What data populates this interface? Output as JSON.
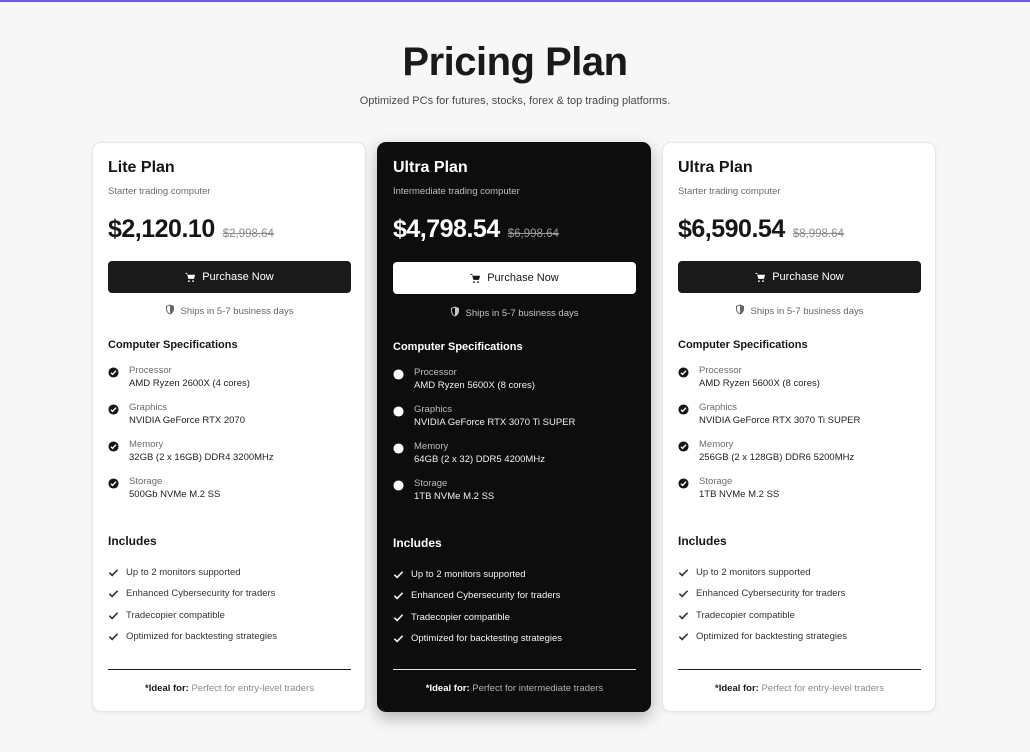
{
  "header": {
    "title": "Pricing Plan",
    "subtitle": "Optimized PCs for futures, stocks, forex & top trading platforms."
  },
  "plans": [
    {
      "name": "Lite Plan",
      "tagline": "Starter trading computer",
      "price": "$2,120.10",
      "old_price": "$2,998.64",
      "button_label": "Purchase Now",
      "ships": "Ships in 5-7 business days",
      "specs_heading": "Computer Specifications",
      "specs": [
        {
          "label": "Processor",
          "value": "AMD Ryzen 2600X (4 cores)"
        },
        {
          "label": "Graphics",
          "value": "NVIDIA GeForce RTX 2070"
        },
        {
          "label": "Memory",
          "value": "32GB (2 x 16GB) DDR4 3200MHz"
        },
        {
          "label": "Storage",
          "value": "500Gb NVMe M.2 SS"
        }
      ],
      "includes_heading": "Includes",
      "includes": [
        "Up to 2 monitors supported",
        "Enhanced Cybersecurity for traders",
        "Tradecopier compatible",
        "Optimized for backtesting strategies"
      ],
      "ideal_label": "*Ideal for:",
      "ideal_text": "Perfect for entry-level traders"
    },
    {
      "name": "Ultra Plan",
      "tagline": "Intermediate trading computer",
      "price": "$4,798.54",
      "old_price": "$6,998.64",
      "button_label": "Purchase Now",
      "ships": "Ships in 5-7 business days",
      "specs_heading": "Computer Specifications",
      "specs": [
        {
          "label": "Processor",
          "value": "AMD Ryzen 5600X (8 cores)"
        },
        {
          "label": "Graphics",
          "value": "NVIDIA GeForce RTX 3070 Ti SUPER"
        },
        {
          "label": "Memory",
          "value": "64GB (2 x 32) DDR5 4200MHz"
        },
        {
          "label": "Storage",
          "value": "1TB NVMe M.2 SS"
        }
      ],
      "includes_heading": "Includes",
      "includes": [
        "Up to 2 monitors supported",
        "Enhanced Cybersecurity for traders",
        "Tradecopier compatible",
        "Optimized for backtesting strategies"
      ],
      "ideal_label": "*Ideal for:",
      "ideal_text": "Perfect for intermediate traders"
    },
    {
      "name": "Ultra Plan",
      "tagline": "Starter trading computer",
      "price": "$6,590.54",
      "old_price": "$8,998.64",
      "button_label": "Purchase Now",
      "ships": "Ships in 5-7 business days",
      "specs_heading": "Computer Specifications",
      "specs": [
        {
          "label": "Processor",
          "value": "AMD Ryzen 5600X (8 cores)"
        },
        {
          "label": "Graphics",
          "value": "NVIDIA GeForce RTX 3070 Ti SUPER"
        },
        {
          "label": "Memory",
          "value": "256GB (2 x 128GB) DDR6 5200MHz"
        },
        {
          "label": "Storage",
          "value": "1TB NVMe M.2 SS"
        }
      ],
      "includes_heading": "Includes",
      "includes": [
        "Up to 2 monitors supported",
        "Enhanced Cybersecurity for traders",
        "Tradecopier compatible",
        "Optimized for backtesting strategies"
      ],
      "ideal_label": "*Ideal for:",
      "ideal_text": "Perfect for entry-level traders"
    }
  ],
  "icons": {
    "cart": "cart-icon",
    "shield": "shield-icon",
    "spec_check": "check-circle-icon",
    "include_check": "check-icon"
  },
  "colors": {
    "accent_bar": "#6d5fd6",
    "dark_card": "#0d0d0d",
    "button_dark": "#1a1a1a"
  }
}
